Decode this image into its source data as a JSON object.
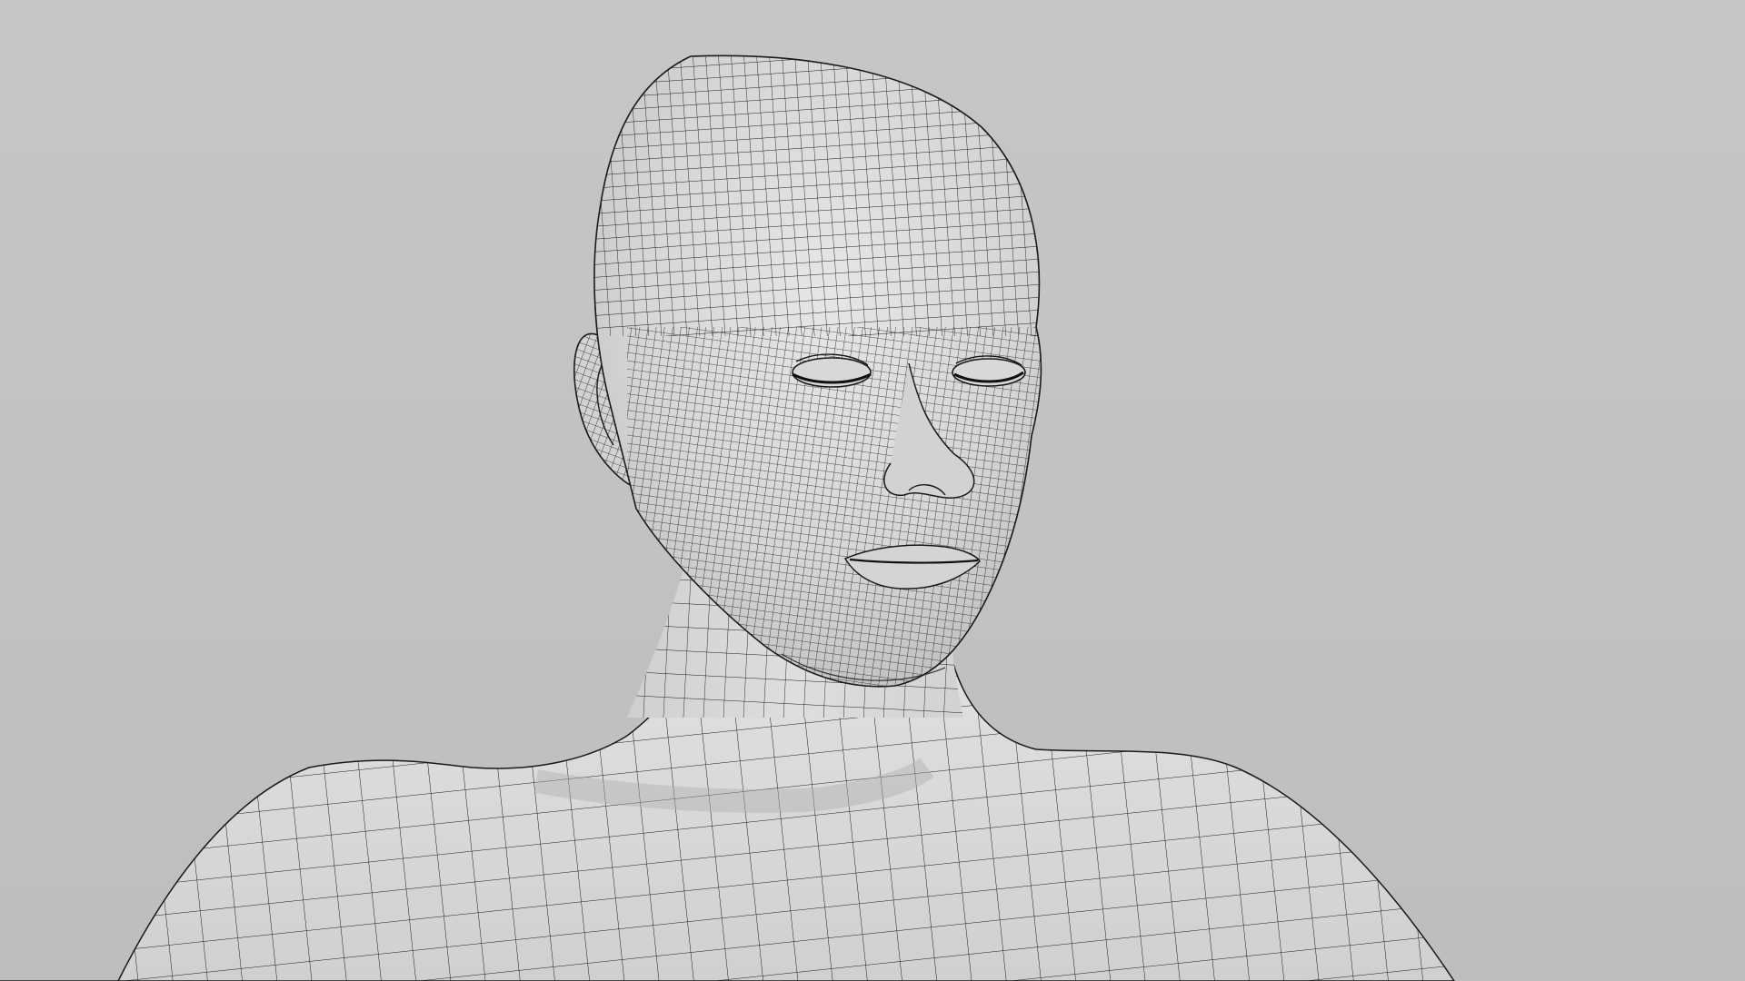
{
  "scene": {
    "subject": "wireframe-head-and-shoulders-render",
    "background_color": "#c2c2c2",
    "surface_color": "#dcdcdc",
    "wire_color": "#1a1a1a",
    "shadow_color": "#b4b4b4"
  }
}
